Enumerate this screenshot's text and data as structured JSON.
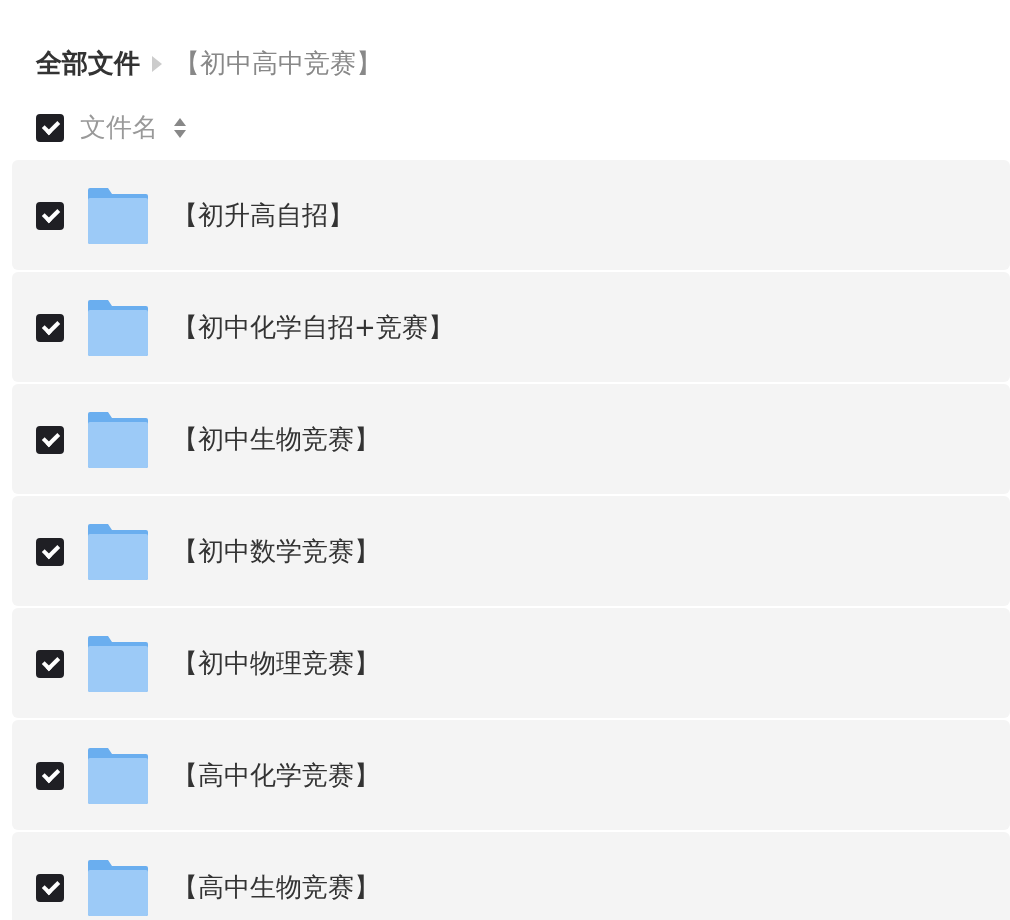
{
  "breadcrumb": [
    {
      "label": "全部文件",
      "current": false
    },
    {
      "label": "【初中高中竞赛】",
      "current": true
    }
  ],
  "header": {
    "checked": true,
    "column": "文件名"
  },
  "files": [
    {
      "name": "【初升高自招】",
      "checked": true
    },
    {
      "name": "【初中化学自招+竞赛】",
      "checked": true
    },
    {
      "name": "【初中生物竞赛】",
      "checked": true
    },
    {
      "name": "【初中数学竞赛】",
      "checked": true
    },
    {
      "name": "【初中物理竞赛】",
      "checked": true
    },
    {
      "name": "【高中化学竞赛】",
      "checked": true
    },
    {
      "name": "【高中生物竞赛】",
      "checked": true
    }
  ]
}
